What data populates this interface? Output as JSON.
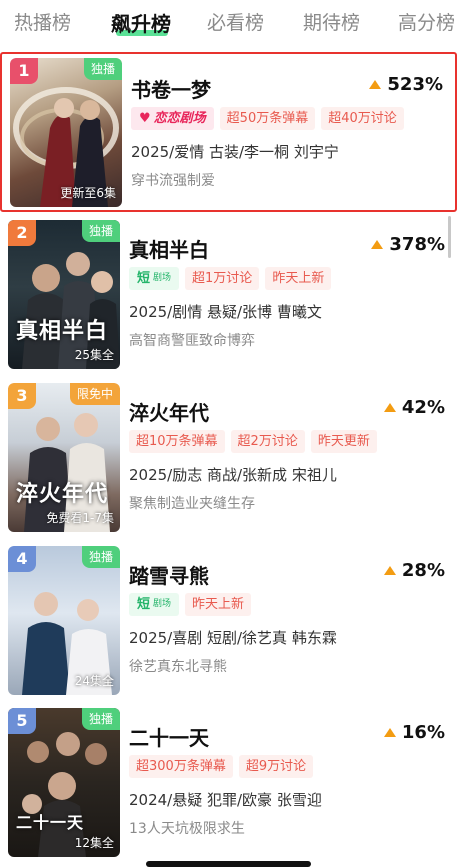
{
  "tabs": [
    {
      "label": "热播榜"
    },
    {
      "label": "飙升榜"
    },
    {
      "label": "必看榜"
    },
    {
      "label": "期待榜"
    },
    {
      "label": "高分榜"
    }
  ],
  "colors": {
    "accent_green": "#3ddc84",
    "highlight_border": "#e8322e",
    "rank1": "#e8506b",
    "rank2": "#f07a3c",
    "rank3": "#f3a43a",
    "rank4_5": "#6c8fd6"
  },
  "items": [
    {
      "rank": "1",
      "badge": "独播",
      "title": "书卷一梦",
      "heat": "523%",
      "platform": "恋恋剧场",
      "platform_icon": "heart-icon",
      "chips": [
        "超50万条弹幕",
        "超40万讨论"
      ],
      "meta": "2025/爱情 古装/李一桐 刘宇宁",
      "desc": "穿书流强制爱",
      "poster_text": "更新至6集",
      "poster_big": ""
    },
    {
      "rank": "2",
      "badge": "独播",
      "title": "真相半白",
      "heat": "378%",
      "platform_main": "短",
      "platform_sub": "剧场",
      "chips": [
        "超1万讨论",
        "昨天上新"
      ],
      "meta": "2025/剧情 悬疑/张博 曹曦文",
      "desc": "高智商警匪致命博弈",
      "poster_text": "25集全",
      "poster_big": "真相半白"
    },
    {
      "rank": "3",
      "badge": "限免中",
      "title": "淬火年代",
      "heat": "42%",
      "chips": [
        "超10万条弹幕",
        "超2万讨论",
        "昨天更新"
      ],
      "meta": "2025/励志 商战/张新成 宋祖儿",
      "desc": "聚焦制造业夹缝生存",
      "poster_text": "免费看1-7集",
      "poster_big": "淬火年代"
    },
    {
      "rank": "4",
      "badge": "独播",
      "title": "踏雪寻熊",
      "heat": "28%",
      "platform_main": "短",
      "platform_sub": "剧场",
      "chips": [
        "昨天上新"
      ],
      "meta": "2025/喜剧 短剧/徐艺真 韩东霖",
      "desc": "徐艺真东北寻熊",
      "poster_text": "24集全",
      "poster_big": ""
    },
    {
      "rank": "5",
      "badge": "独播",
      "title": "二十一天",
      "heat": "16%",
      "chips": [
        "超300万条弹幕",
        "超9万讨论"
      ],
      "meta": "2024/悬疑 犯罪/欧豪 张雪迎",
      "desc": "13人天坑极限求生",
      "poster_text": "12集全",
      "poster_big": "二十一天"
    }
  ]
}
